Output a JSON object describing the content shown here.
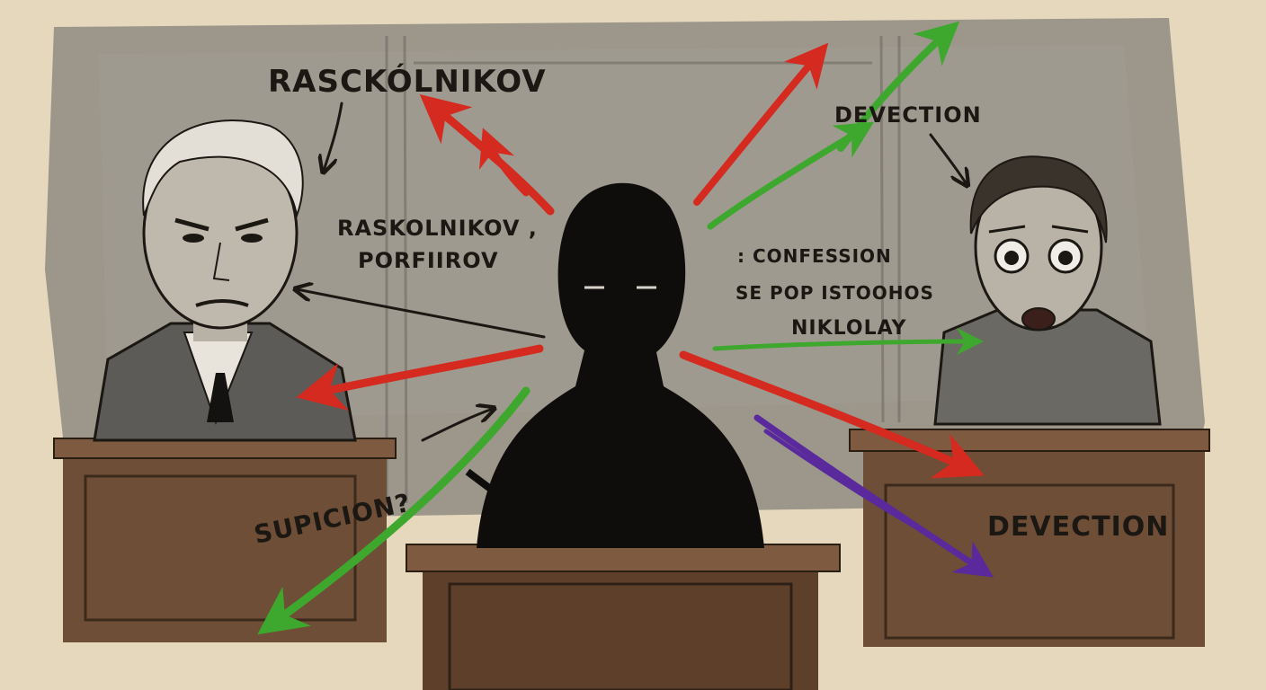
{
  "labels": {
    "top_left": "RASCKÓLNIKOV",
    "middle_left_line1": "RASKOLNIKOV ,",
    "middle_left_line2": "PORFIIROV",
    "top_right": "DEVECTION",
    "middle_right_line1": ": CONFESSION",
    "middle_right_line2": "SE POP ISTOOHOS",
    "middle_right_line3": "NIKLOLAY",
    "bottom_left": "SUPICION?",
    "bottom_right": "DEVECTION"
  },
  "colors": {
    "paper": "#e6d8bd",
    "wall": "#8c8a82",
    "silhouette": "#0f0d0c",
    "podium": "#6b4a32",
    "arrow_red": "#d42a1f",
    "arrow_green": "#3ea82e",
    "arrow_purple": "#5a2a9c",
    "ink": "#1b1712"
  },
  "figures": {
    "left": "stern-old-man-portrait",
    "center": "shadow-silhouette",
    "right": "frightened-man-portrait"
  }
}
